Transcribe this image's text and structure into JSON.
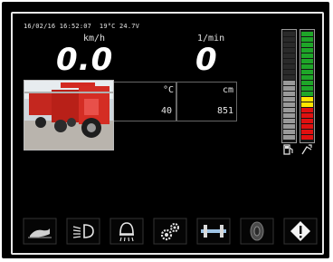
{
  "status_bar": {
    "date": "16/02/16",
    "time": "16:52:07",
    "temperature": "19°C",
    "voltage": "24.7V"
  },
  "speed": {
    "unit": "km/h",
    "value": "0.0"
  },
  "rpm": {
    "unit": "1/min",
    "value": "0"
  },
  "readouts": {
    "temp_unit": "°C",
    "temp_value": "40",
    "dist_unit": "cm",
    "dist_value": "851"
  },
  "gauges": {
    "fuel": {
      "icon": "fuel-pump-icon",
      "level": 0.56,
      "color": "#9a9a9a"
    },
    "hydraulic": {
      "icon": "hydraulic-icon",
      "level": 1.0,
      "colors": [
        "#1ea628",
        "#ffe600",
        "#e01010"
      ]
    }
  },
  "softkeys": [
    {
      "name": "field-mode-key",
      "icon": "field-ground-icon"
    },
    {
      "name": "lights-key",
      "icon": "headlight-icon"
    },
    {
      "name": "work-light-key",
      "icon": "work-light-icon"
    },
    {
      "name": "settings-key",
      "icon": "gears-icon"
    },
    {
      "name": "axle-key",
      "icon": "axle-icon"
    },
    {
      "name": "wheel-key",
      "icon": "wheel-icon"
    },
    {
      "name": "warning-key",
      "icon": "warning-diamond-icon"
    }
  ]
}
